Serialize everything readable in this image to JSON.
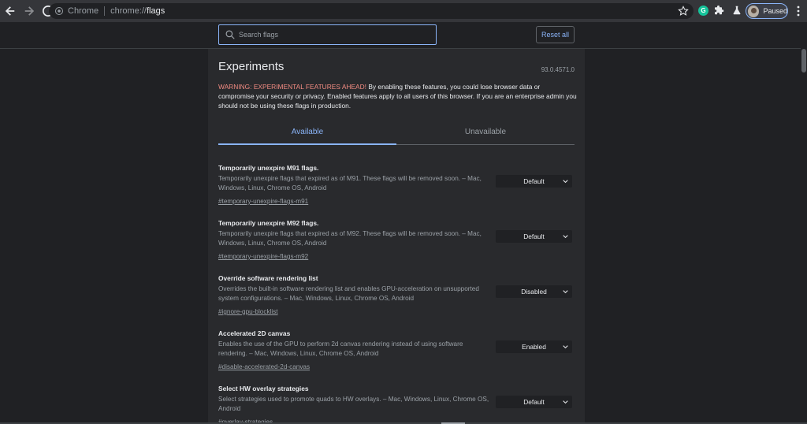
{
  "browser": {
    "scheme_label": "Chrome",
    "url_prefix": "chrome://",
    "url_path": "flags",
    "grammarly_letter": "G",
    "profile_status": "Paused"
  },
  "header": {
    "search_placeholder": "Search flags",
    "reset_label": "Reset all"
  },
  "page": {
    "title": "Experiments",
    "version": "93.0.4571.0",
    "warning_strong": "WARNING: EXPERIMENTAL FEATURES AHEAD!",
    "warning_text": " By enabling these features, you could lose browser data or compromise your security or privacy. Enabled features apply to all users of this browser. If you are an enterprise admin you should not be using these flags in production."
  },
  "tabs": [
    {
      "label": "Available"
    },
    {
      "label": "Unavailable"
    }
  ],
  "flags": [
    {
      "name": "Temporarily unexpire M91 flags.",
      "description": "Temporarily unexpire flags that expired as of M91. These flags will be removed soon. – Mac, Windows, Linux, Chrome OS, Android",
      "link": "#temporary-unexpire-flags-m91",
      "value": "Default"
    },
    {
      "name": "Temporarily unexpire M92 flags.",
      "description": "Temporarily unexpire flags that expired as of M92. These flags will be removed soon. – Mac, Windows, Linux, Chrome OS, Android",
      "link": "#temporary-unexpire-flags-m92",
      "value": "Default"
    },
    {
      "name": "Override software rendering list",
      "description": "Overrides the built-in software rendering list and enables GPU-acceleration on unsupported system configurations. – Mac, Windows, Linux, Chrome OS, Android",
      "link": "#ignore-gpu-blocklist",
      "value": "Disabled"
    },
    {
      "name": "Accelerated 2D canvas",
      "description": "Enables the use of the GPU to perform 2d canvas rendering instead of using software rendering. – Mac, Windows, Linux, Chrome OS, Android",
      "link": "#disable-accelerated-2d-canvas",
      "value": "Enabled"
    },
    {
      "name": "Select HW overlay strategies",
      "description": "Select strategies used to promote quads to HW overlays. – Mac, Windows, Linux, Chrome OS, Android",
      "link": "#overlay-strategies",
      "value": "Default"
    }
  ],
  "colors": {
    "accent": "#8ab4f8",
    "warning": "#f28b82",
    "background": "#202124",
    "panel": "#292a2d"
  }
}
